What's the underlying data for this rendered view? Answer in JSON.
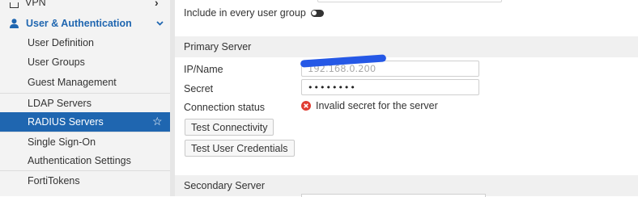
{
  "sidebar": {
    "vpn": {
      "label": "VPN",
      "icon": "monitor-icon",
      "chevron": "›"
    },
    "user_auth": {
      "label": "User & Authentication",
      "icon": "user-icon",
      "chevron": "⌄"
    },
    "items": [
      {
        "label": "User Definition"
      },
      {
        "label": "User Groups"
      },
      {
        "label": "Guest Management"
      },
      {
        "label": "LDAP Servers"
      },
      {
        "label": "RADIUS Servers",
        "active": true,
        "star": "☆"
      },
      {
        "label": "Single Sign-On"
      },
      {
        "label": "Authentication Settings"
      },
      {
        "label": "FortiTokens"
      }
    ]
  },
  "main": {
    "include_every_group": {
      "label": "Include in every user group",
      "state": "off"
    },
    "primary": {
      "header": "Primary Server",
      "ip_label": "IP/Name",
      "ip_value": "192.168.0.200",
      "secret_label": "Secret",
      "secret_value": "••••••••",
      "status_label": "Connection status",
      "status_text": "Invalid secret for the server",
      "test_connectivity": "Test Connectivity",
      "test_credentials": "Test User Credentials"
    },
    "secondary": {
      "header": "Secondary Server"
    }
  },
  "colors": {
    "active_bg": "#1f66b0",
    "error": "#e03c31",
    "section_bg": "#f0f0f0"
  }
}
